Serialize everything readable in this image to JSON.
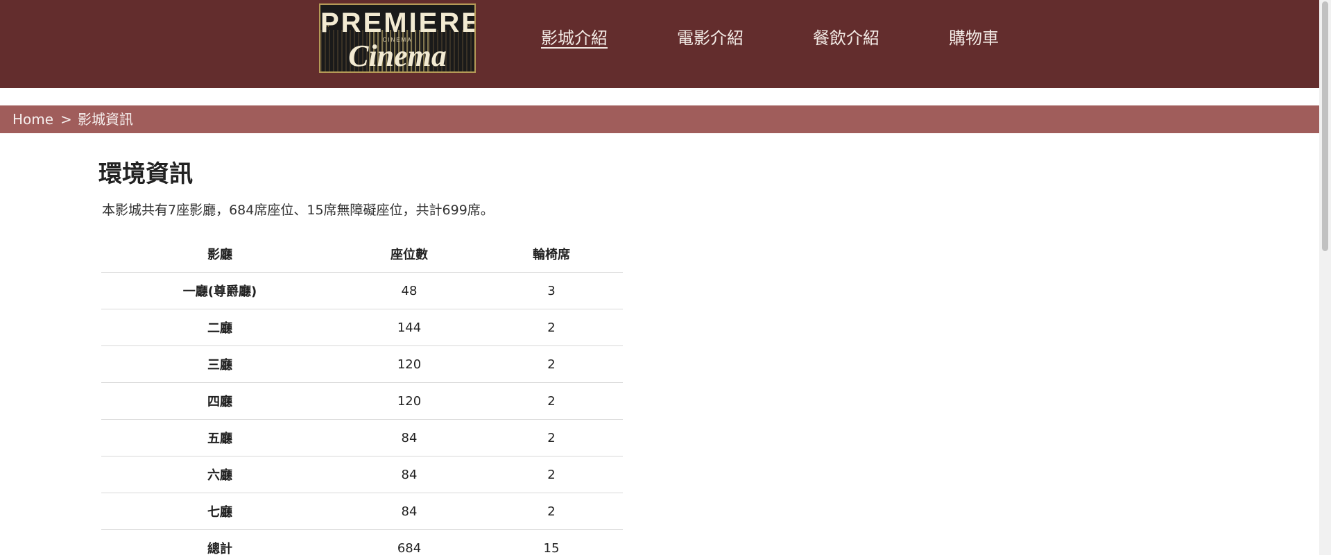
{
  "header": {
    "logo": {
      "line1": "PREMIERE",
      "line2": "CINEMA",
      "script": "Cinema",
      "left_mark": "17",
      "right_mark": "30"
    },
    "nav": [
      {
        "label": "影城介紹",
        "active": true
      },
      {
        "label": "電影介紹",
        "active": false
      },
      {
        "label": "餐飲介紹",
        "active": false
      },
      {
        "label": "購物車",
        "active": false
      }
    ]
  },
  "breadcrumb": {
    "home": "Home",
    "separator": ">",
    "current": "影城資訊"
  },
  "content": {
    "title": "環境資訊",
    "summary": "本影城共有7座影廳，684席座位、15席無障礙座位，共計699席。",
    "table": {
      "headers": [
        "影廳",
        "座位數",
        "輪椅席"
      ],
      "rows": [
        [
          "一廳(尊爵廳)",
          "48",
          "3"
        ],
        [
          "二廳",
          "144",
          "2"
        ],
        [
          "三廳",
          "120",
          "2"
        ],
        [
          "四廳",
          "120",
          "2"
        ],
        [
          "五廳",
          "84",
          "2"
        ],
        [
          "六廳",
          "84",
          "2"
        ],
        [
          "七廳",
          "84",
          "2"
        ],
        [
          "總計",
          "684",
          "15"
        ]
      ]
    }
  },
  "colors": {
    "header_bg": "#632d2d",
    "breadcrumb_bg": "#a05d5b",
    "logo_gold": "#b59a57"
  }
}
